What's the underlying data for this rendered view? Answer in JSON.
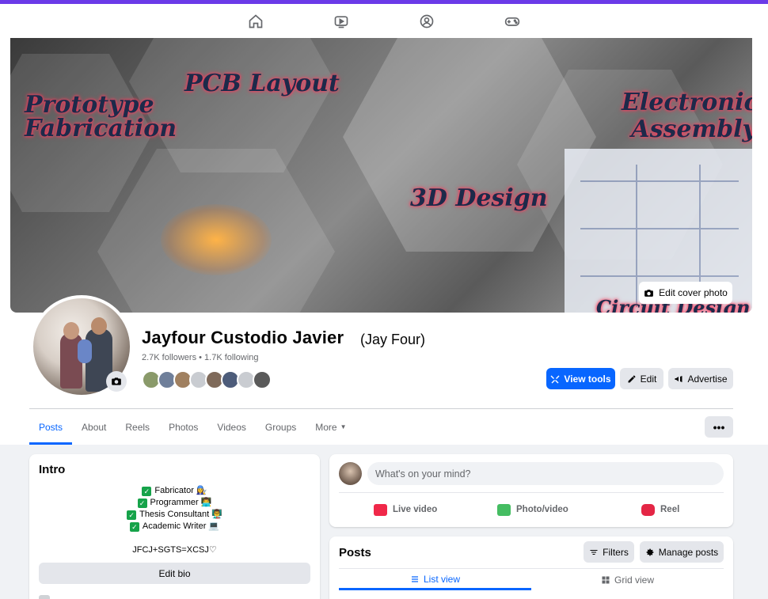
{
  "topnav": {
    "items": [
      {
        "icon": "home-icon"
      },
      {
        "icon": "video-icon"
      },
      {
        "icon": "groups-icon"
      },
      {
        "icon": "gaming-icon"
      }
    ]
  },
  "cover": {
    "labels": [
      "Prototype Fabrication",
      "PCB Layout",
      "3D Design",
      "Electronics Assembly",
      "Circuit Design"
    ],
    "edit_cover_label": "Edit cover photo"
  },
  "profile": {
    "name": "Jayfour Custodio Javier",
    "alt_name": "(Jay Four)",
    "stats": "2.7K followers • 1.7K following",
    "friend_colors": [
      "#8a9a6a",
      "#6f7f9a",
      "#a08060",
      "#c9ccd1",
      "#7f6a5a",
      "#4d5c7a",
      "#c9ccd1",
      "#5a5a5a"
    ]
  },
  "actions": {
    "view_tools": "View tools",
    "edit": "Edit",
    "advertise": "Advertise"
  },
  "tabs": [
    {
      "label": "Posts",
      "active": true
    },
    {
      "label": "About"
    },
    {
      "label": "Reels"
    },
    {
      "label": "Photos"
    },
    {
      "label": "Videos"
    },
    {
      "label": "Groups"
    },
    {
      "label": "More",
      "dropdown": true
    }
  ],
  "more_menu_label": "•••",
  "intro": {
    "title": "Intro",
    "bio_lines": [
      "Fabricator 👩‍🔧",
      "Programmer 👨‍💻",
      "Thesis Consultant 👨‍🏫",
      "Academic Writer 💻"
    ],
    "tagline": "JFCJ+SGTS=XCSJ♡",
    "edit_bio": "Edit bio"
  },
  "composer": {
    "placeholder": "What's on your mind?",
    "actions": [
      {
        "label": "Live video",
        "color": "#f02849"
      },
      {
        "label": "Photo/video",
        "color": "#45bd62"
      },
      {
        "label": "Reel",
        "color": "#e42645"
      }
    ]
  },
  "posts": {
    "title": "Posts",
    "filters": "Filters",
    "manage": "Manage posts",
    "list_view": "List view",
    "grid_view": "Grid view"
  }
}
